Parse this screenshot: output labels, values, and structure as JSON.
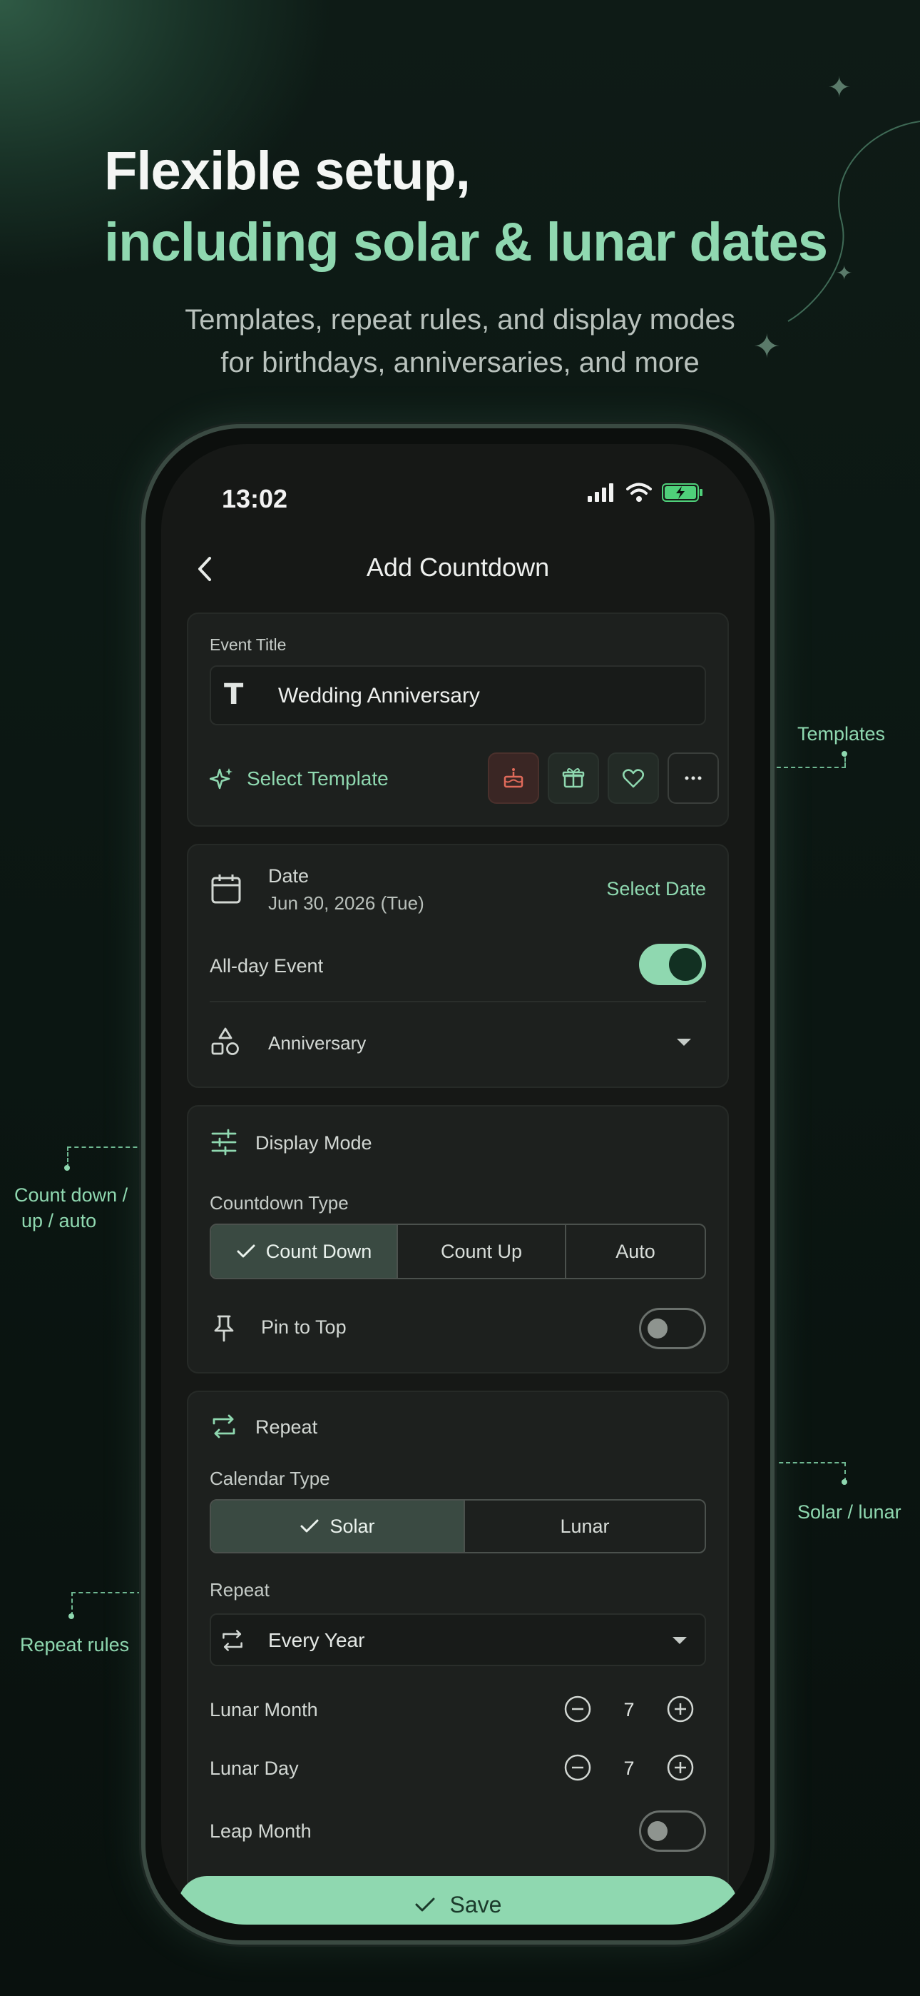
{
  "headline": {
    "line1": "Flexible setup,",
    "line2": "including solar & lunar dates"
  },
  "subhead": {
    "line1": "Templates, repeat rules, and display modes",
    "line2": "for birthdays, anniversaries, and more"
  },
  "status_bar": {
    "time": "13:02"
  },
  "nav": {
    "title": "Add Countdown"
  },
  "event": {
    "title_label": "Event Title",
    "title_value": "Wedding Anniversary",
    "select_template": "Select Template",
    "templates": [
      "cake-icon",
      "gift-icon",
      "heart-icon",
      "more-icon"
    ]
  },
  "date_section": {
    "date_label": "Date",
    "date_value": "Jun 30, 2026 (Tue)",
    "select_date": "Select Date",
    "all_day_label": "All-day Event",
    "all_day_on": true,
    "category": "Anniversary"
  },
  "display_section": {
    "header": "Display Mode",
    "countdown_type_label": "Countdown Type",
    "options": [
      "Count Down",
      "Count Up",
      "Auto"
    ],
    "selected": "Count Down",
    "pin_label": "Pin to Top",
    "pin_on": false
  },
  "repeat_section": {
    "header": "Repeat",
    "calendar_type_label": "Calendar Type",
    "calendar_options": [
      "Solar",
      "Lunar"
    ],
    "calendar_selected": "Solar",
    "repeat_label": "Repeat",
    "repeat_value": "Every Year",
    "lunar_month_label": "Lunar Month",
    "lunar_month_value": "7",
    "lunar_day_label": "Lunar Day",
    "lunar_day_value": "7",
    "leap_month_label": "Leap Month",
    "leap_month_on": false
  },
  "save_label": "Save",
  "annotations": {
    "templates": "Templates",
    "count_line1": "Count down /",
    "count_line2": "up / auto",
    "solar_lunar": "Solar / lunar",
    "repeat_rules": "Repeat rules"
  },
  "colors": {
    "accent": "#8fd8b0",
    "background": "#0b1612",
    "card": "#1d201e"
  }
}
